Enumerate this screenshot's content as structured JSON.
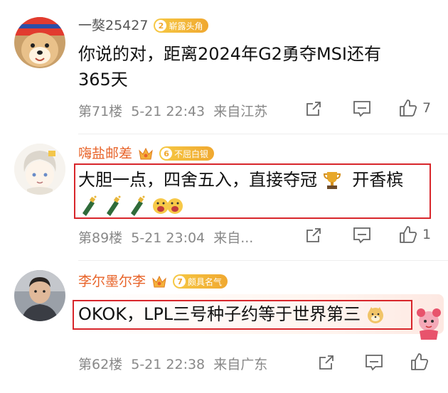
{
  "comments": [
    {
      "username": "一獒25427",
      "badge_level": "2",
      "badge_text": "崭露头角",
      "text_line1": "你说的对，距离2024年G2勇夺MSI还有",
      "text_line2": "365天",
      "floor": "第71楼",
      "time": "5-21 22:43",
      "location": "来自江苏",
      "like_count": "7"
    },
    {
      "username": "嗨盐邮差",
      "badge_level": "6",
      "badge_text": "不屈白银",
      "text_line1": "大胆一点，四舍五入，直接夺冠",
      "text_line1_tail": "开香槟",
      "floor": "第89楼",
      "time": "5-21 23:04",
      "location": "来自...",
      "like_count": "1"
    },
    {
      "username": "李尔墨尔李",
      "badge_level": "7",
      "badge_text": "颇具名气",
      "text_line1": "OKOK，LPL三号种子约等于世界第三",
      "floor": "第62楼",
      "time": "5-21 22:38",
      "location": "来自广东",
      "like_count": ""
    }
  ],
  "colors": {
    "vip_name": "#e8642a",
    "highlight_box": "#d8262b",
    "badge": "#f0a830"
  },
  "icons": [
    "share-icon",
    "comment-icon",
    "like-icon",
    "crown-icon",
    "trophy-icon",
    "champagne-icon",
    "cheering-emoji-icon",
    "doge-emoji-icon",
    "sticker-icon"
  ]
}
